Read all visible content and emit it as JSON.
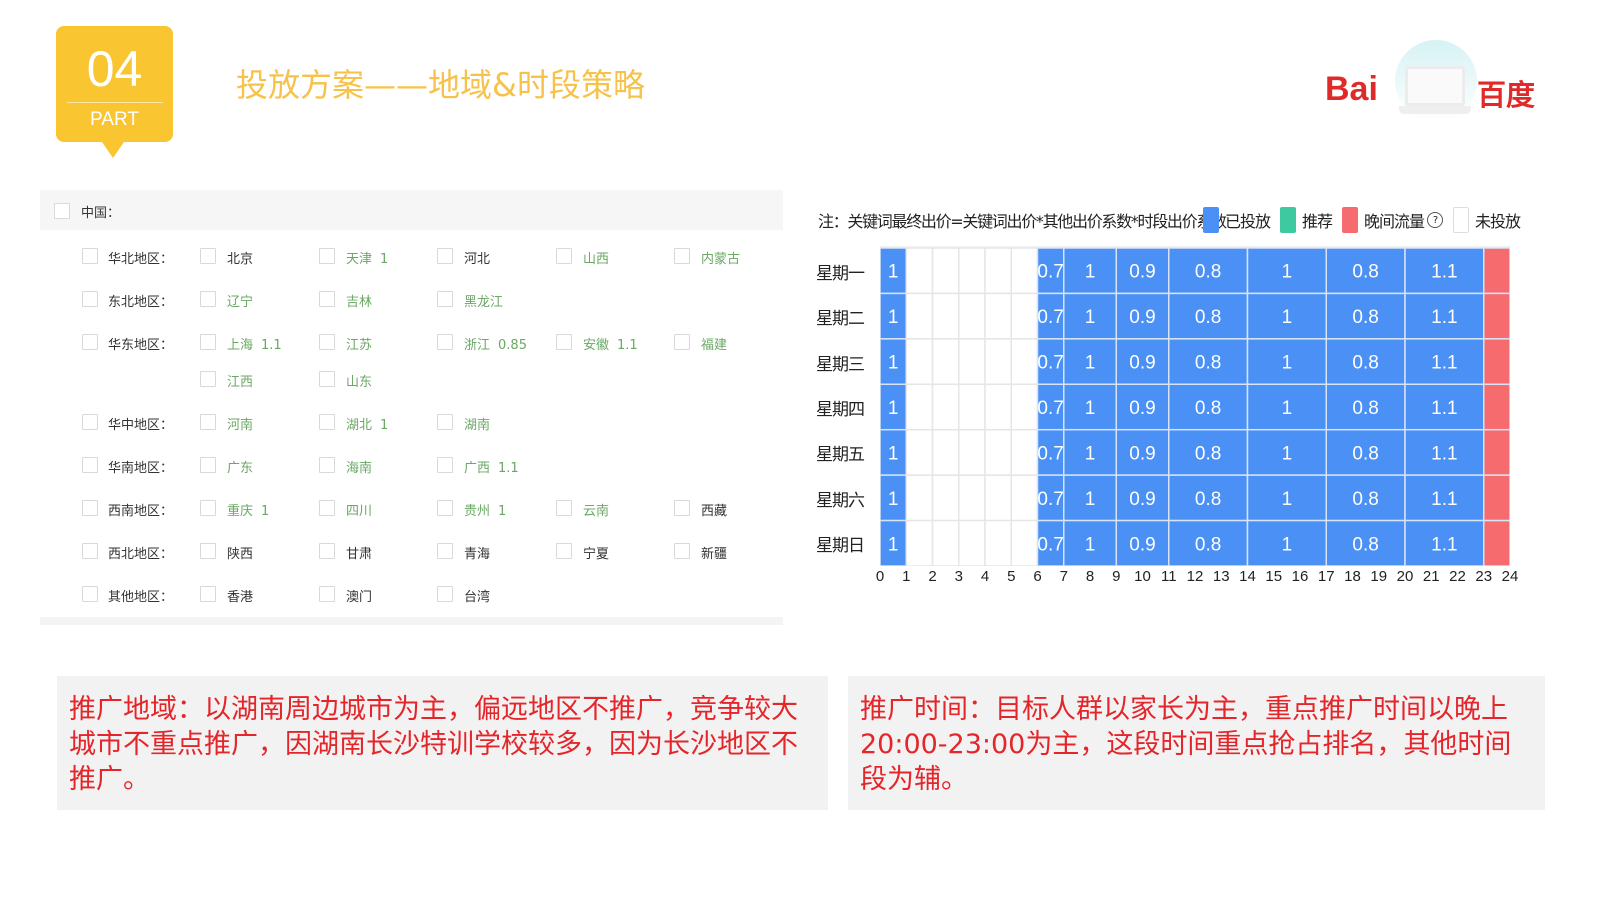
{
  "header": {
    "part_number": "04",
    "part_label": "PART",
    "title": "投放方案——地域&时段策略"
  },
  "logo": {
    "left_text": "Bai",
    "right_text": "百度",
    "icon": "laptop-icon"
  },
  "region_panel": {
    "root_label": "中国：",
    "regions": [
      {
        "name": "华北地区：",
        "provinces": [
          {
            "name": "北京",
            "coef": "",
            "active": false
          },
          {
            "name": "天津",
            "coef": "1",
            "active": true
          },
          {
            "name": "河北",
            "coef": "",
            "active": false
          },
          {
            "name": "山西",
            "coef": "",
            "active": true
          },
          {
            "name": "内蒙古",
            "coef": "",
            "active": true
          }
        ]
      },
      {
        "name": "东北地区：",
        "provinces": [
          {
            "name": "辽宁",
            "coef": "",
            "active": true
          },
          {
            "name": "吉林",
            "coef": "",
            "active": true
          },
          {
            "name": "黑龙江",
            "coef": "",
            "active": true
          }
        ]
      },
      {
        "name": "华东地区：",
        "provinces": [
          {
            "name": "上海",
            "coef": "1.1",
            "active": true
          },
          {
            "name": "江苏",
            "coef": "",
            "active": true
          },
          {
            "name": "浙江",
            "coef": "0.85",
            "active": true
          },
          {
            "name": "安徽",
            "coef": "1.1",
            "active": true
          },
          {
            "name": "福建",
            "coef": "",
            "active": true
          },
          {
            "name": "江西",
            "coef": "",
            "active": true
          },
          {
            "name": "山东",
            "coef": "",
            "active": true
          }
        ]
      },
      {
        "name": "华中地区：",
        "provinces": [
          {
            "name": "河南",
            "coef": "",
            "active": true
          },
          {
            "name": "湖北",
            "coef": "1",
            "active": true
          },
          {
            "name": "湖南",
            "coef": "",
            "active": true
          }
        ]
      },
      {
        "name": "华南地区：",
        "provinces": [
          {
            "name": "广东",
            "coef": "",
            "active": true
          },
          {
            "name": "海南",
            "coef": "",
            "active": true
          },
          {
            "name": "广西",
            "coef": "1.1",
            "active": true
          }
        ]
      },
      {
        "name": "西南地区：",
        "provinces": [
          {
            "name": "重庆",
            "coef": "1",
            "active": true
          },
          {
            "name": "四川",
            "coef": "",
            "active": true
          },
          {
            "name": "贵州",
            "coef": "1",
            "active": true
          },
          {
            "name": "云南",
            "coef": "",
            "active": true
          },
          {
            "name": "西藏",
            "coef": "",
            "active": false
          }
        ]
      },
      {
        "name": "西北地区：",
        "provinces": [
          {
            "name": "陕西",
            "coef": "",
            "active": false
          },
          {
            "name": "甘肃",
            "coef": "",
            "active": false
          },
          {
            "name": "青海",
            "coef": "",
            "active": false
          },
          {
            "name": "宁夏",
            "coef": "",
            "active": false
          },
          {
            "name": "新疆",
            "coef": "",
            "active": false
          }
        ]
      },
      {
        "name": "其他地区：",
        "provinces": [
          {
            "name": "香港",
            "coef": "",
            "active": false
          },
          {
            "name": "澳门",
            "coef": "",
            "active": false
          },
          {
            "name": "台湾",
            "coef": "",
            "active": false
          }
        ]
      }
    ]
  },
  "schedule": {
    "note": "注：关键词最终出价=关键词出价*其他出价系数*时段出价系数",
    "legend": [
      {
        "label": "已投放",
        "color": "#4a90f5",
        "key": "placed"
      },
      {
        "label": "推荐",
        "color": "#3ec9a0",
        "key": "recommended"
      },
      {
        "label": "晚间流量",
        "color": "#f56b6e",
        "key": "evening",
        "help_icon": "?"
      },
      {
        "label": "未投放",
        "color": "#ffffff",
        "key": "none"
      }
    ],
    "days": [
      "星期一",
      "星期二",
      "星期三",
      "星期四",
      "星期五",
      "星期六",
      "星期日"
    ],
    "hours": [
      "0",
      "1",
      "2",
      "3",
      "4",
      "5",
      "6",
      "7",
      "8",
      "9",
      "10",
      "11",
      "12",
      "13",
      "14",
      "15",
      "16",
      "17",
      "18",
      "19",
      "20",
      "21",
      "22",
      "23",
      "24"
    ],
    "segments": [
      {
        "start": 0,
        "end": 1,
        "value": "1",
        "status": "placed"
      },
      {
        "start": 1,
        "end": 2,
        "value": "",
        "status": "none"
      },
      {
        "start": 2,
        "end": 3,
        "value": "",
        "status": "none"
      },
      {
        "start": 3,
        "end": 4,
        "value": "",
        "status": "none"
      },
      {
        "start": 4,
        "end": 5,
        "value": "",
        "status": "none"
      },
      {
        "start": 5,
        "end": 6,
        "value": "",
        "status": "none"
      },
      {
        "start": 6,
        "end": 7,
        "value": "0.7",
        "status": "placed"
      },
      {
        "start": 7,
        "end": 9,
        "value": "1",
        "status": "placed"
      },
      {
        "start": 9,
        "end": 11,
        "value": "0.9",
        "status": "placed"
      },
      {
        "start": 11,
        "end": 14,
        "value": "0.8",
        "status": "placed"
      },
      {
        "start": 14,
        "end": 17,
        "value": "1",
        "status": "placed"
      },
      {
        "start": 17,
        "end": 20,
        "value": "0.8",
        "status": "placed"
      },
      {
        "start": 20,
        "end": 23,
        "value": "1.1",
        "status": "placed"
      },
      {
        "start": 23,
        "end": 24,
        "value": "",
        "status": "evening"
      }
    ]
  },
  "info": {
    "region_text": "推广地域：以湖南周边城市为主，偏远地区不推广，竞争较大城市不重点推广，因湖南长沙特训学校较多，因为长沙地区不推广。",
    "time_text": "推广时间：目标人群以家长为主，重点推广时间以晚上20:00-23:00为主，这段时间重点抢占排名，其他时间段为辅。"
  },
  "colors": {
    "accent_yellow": "#f9c531",
    "title_yellow": "#f7c24a",
    "active_green": "#6aa864",
    "info_red": "#e4262b"
  }
}
